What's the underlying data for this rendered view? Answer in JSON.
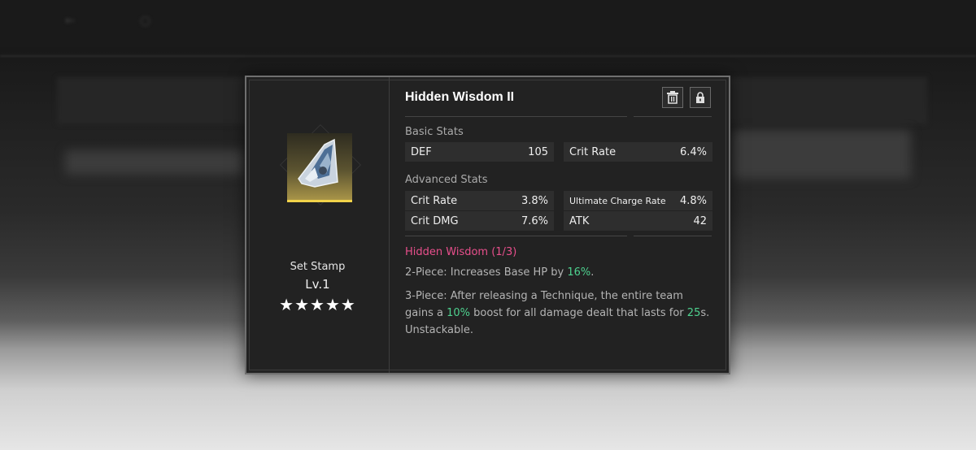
{
  "item": {
    "title": "Hidden Wisdom II",
    "category": "Set Stamp",
    "level": "Lv.1",
    "stars": "★★★★★"
  },
  "basic_stats": {
    "heading": "Basic Stats",
    "stats": [
      {
        "name": "DEF",
        "value": "105"
      },
      {
        "name": "Crit Rate",
        "value": "6.4%"
      }
    ]
  },
  "advanced_stats": {
    "heading": "Advanced Stats",
    "stats": [
      {
        "name": "Crit Rate",
        "value": "3.8%"
      },
      {
        "name": "Ultimate Charge Rate",
        "value": "4.8%"
      },
      {
        "name": "Crit DMG",
        "value": "7.6%"
      },
      {
        "name": "ATK",
        "value": "42"
      }
    ]
  },
  "set_bonus": {
    "name": "Hidden Wisdom (1/3)",
    "two_piece": {
      "prefix": "2-Piece:  Increases Base HP by ",
      "value": "16%",
      "suffix": "."
    },
    "three_piece": {
      "prefix": "3-Piece:  After releasing a Technique, the entire team gains a ",
      "value1": "10%",
      "middle": " boost for all damage dealt that lasts for ",
      "value2": "25",
      "suffix": "s. Unstackable."
    }
  },
  "colors": {
    "set_name": "#e84f8c",
    "highlight": "#4ed28f",
    "rarity_bar": "#f2d34a"
  },
  "icons": {
    "delete": "trash-icon",
    "lock": "lock-icon"
  }
}
